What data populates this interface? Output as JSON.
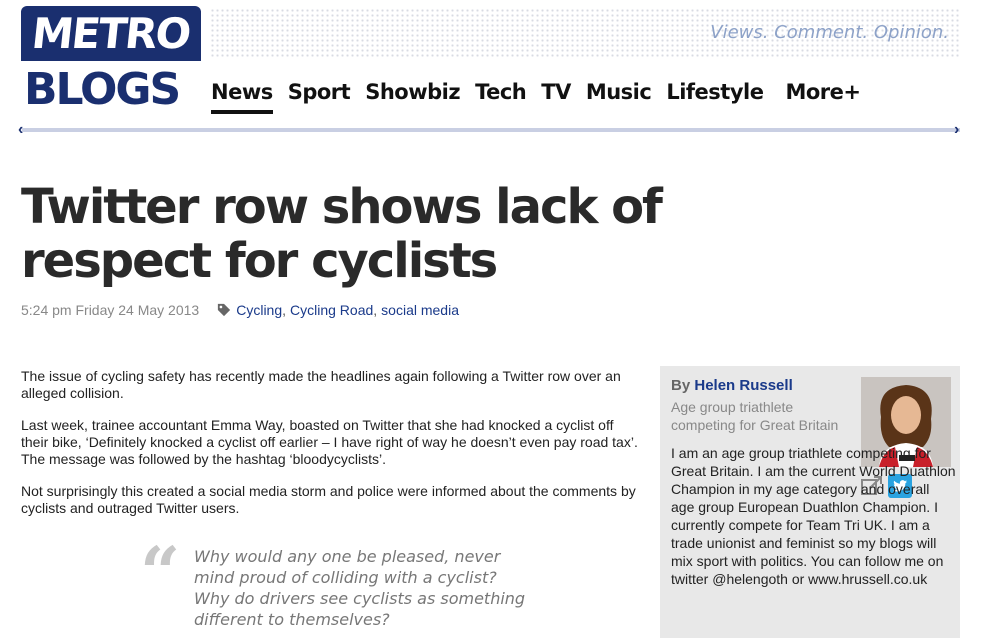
{
  "logo": {
    "top": "METRO",
    "bottom": "BLOGS"
  },
  "tagline": "Views. Comment. Opinion.",
  "nav": [
    "News",
    "Sport",
    "Showbiz",
    "Tech",
    "TV",
    "Music",
    "Lifestyle",
    "More+"
  ],
  "article": {
    "title": "Twitter row shows lack of respect for cyclists",
    "date": "5:24 pm Friday 24 May 2013",
    "tags": [
      "Cycling",
      "Cycling Road",
      "social media"
    ],
    "paragraphs": [
      "The issue of cycling safety has recently made the headlines again following a Twitter row over an alleged collision.",
      "Last week, trainee accountant Emma Way, boasted on Twitter that she had knocked a cyclist off their bike, ‘Definitely knocked a cyclist off earlier – I have right of way he doesn’t even pay road tax’. The message was followed by the hashtag ‘bloodycyclists’.",
      "Not surprisingly this created a social media storm and police were informed about the comments by cyclists and outraged Twitter users."
    ],
    "pullquote": "Why would any one be pleased, never mind proud of colliding with a cyclist? Why do drivers see cyclists as something different to themselves?"
  },
  "author": {
    "by": "By",
    "name": "Helen Russell",
    "role": "Age group triathlete competing for Great Britain",
    "bio": "I am an age group triathlete competing for Great Britain. I am the current World Duathlon Champion in my age category and overall age group European Duathlon Champion. I currently compete for Team Tri UK. I am a trade unionist and feminist so my blogs will mix sport with politics. You can follow me on twitter @helengoth or www.hrussell.co.uk",
    "icons": [
      "external-link-icon",
      "twitter-icon"
    ]
  },
  "colors": {
    "brand": "#1a2f6f",
    "link": "#1a3a8a",
    "tagline": "#8da2c8",
    "sidebar": "#e8e8e8"
  }
}
